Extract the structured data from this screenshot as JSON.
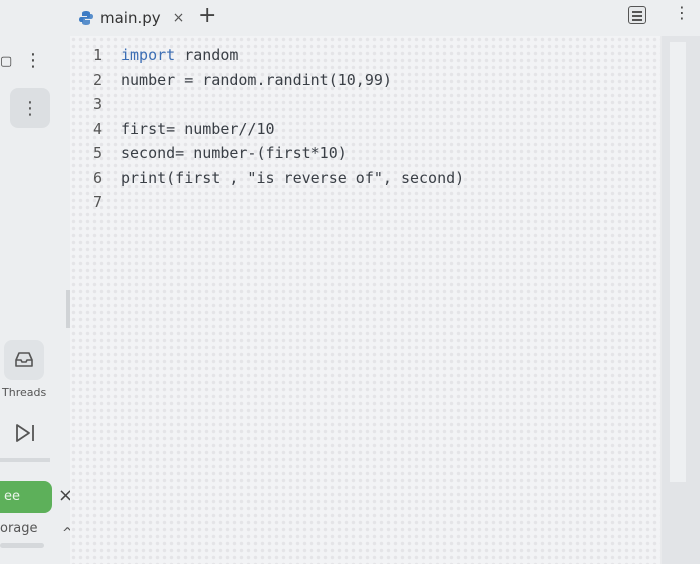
{
  "tab": {
    "filename": "main.py",
    "close": "×",
    "add": "+"
  },
  "sidebar": {
    "threads_label": "Threads",
    "green_button_label": "ee",
    "close": "×",
    "storage_label": "orage",
    "chevron": "^"
  },
  "code": {
    "lines": [
      {
        "num": "1",
        "kw": "import",
        "rest": " random"
      },
      {
        "num": "2",
        "kw": "",
        "rest": "number = random.randint(10,99)"
      },
      {
        "num": "3",
        "kw": "",
        "rest": ""
      },
      {
        "num": "4",
        "kw": "",
        "rest": "first= number//10"
      },
      {
        "num": "5",
        "kw": "",
        "rest": "second= number-(first*10)"
      },
      {
        "num": "6",
        "kw": "",
        "rest": "print(first , \"is reverse of\", second)"
      },
      {
        "num": "7",
        "kw": "",
        "rest": ""
      }
    ]
  },
  "colors": {
    "run_green": "#5db05a",
    "keyword": "#3c6eb4"
  }
}
